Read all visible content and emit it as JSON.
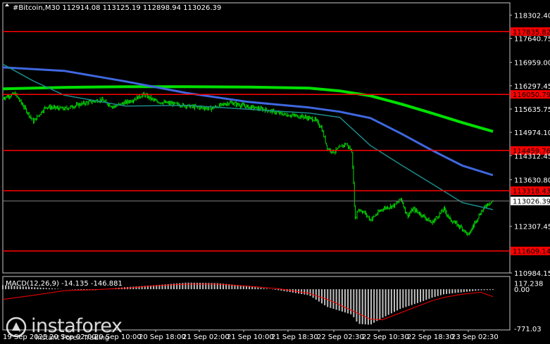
{
  "chart_data": [
    {
      "type": "candlestick",
      "title": "#Bitcoin,M30",
      "ohlc": {
        "open": "112914.08",
        "high": "113125.19",
        "low": "112898.94",
        "close": "113026.39"
      },
      "ylim": [
        110984.15,
        118650
      ],
      "y_ticks": [
        "118302.40",
        "117640.75",
        "116959.00",
        "116297.45",
        "115635.75",
        "114974.10",
        "114312.45",
        "113630.80",
        "112307.45",
        "110984.15"
      ],
      "x_ticks": [
        "19 Sep 2025",
        "20 Sep 02:00",
        "20 Sep 10:00",
        "20 Sep 18:00",
        "21 Sep 02:00",
        "21 Sep 10:00",
        "21 Sep 18:30",
        "22 Sep 02:30",
        "22 Sep 10:30",
        "22 Sep 18:30",
        "23 Sep 02:30"
      ],
      "current_price": "113026.39",
      "levels": [
        {
          "value": 117835.82,
          "label": "117835.82"
        },
        {
          "value": 116050.79,
          "label": "116050.79"
        },
        {
          "value": 114459.76,
          "label": "114459.76"
        },
        {
          "value": 113318.43,
          "label": "113318.43"
        },
        {
          "value": 111609.14,
          "label": "111609.14"
        }
      ],
      "ma_series": [
        {
          "color": "#00e000",
          "points": [
            [
              0,
              116210
            ],
            [
              10,
              116250
            ],
            [
              20,
              116270
            ],
            [
              30,
              116270
            ],
            [
              40,
              116260
            ],
            [
              50,
              116230
            ],
            [
              55,
              116150
            ],
            [
              60,
              116010
            ],
            [
              65,
              115780
            ],
            [
              70,
              115520
            ],
            [
              75,
              115250
            ],
            [
              80,
              115000
            ]
          ]
        },
        {
          "color": "#3f68e0",
          "points": [
            [
              0,
              116820
            ],
            [
              10,
              116720
            ],
            [
              20,
              116420
            ],
            [
              30,
              116090
            ],
            [
              40,
              115840
            ],
            [
              50,
              115680
            ],
            [
              55,
              115560
            ],
            [
              60,
              115380
            ],
            [
              65,
              114940
            ],
            [
              70,
              114470
            ],
            [
              75,
              114030
            ],
            [
              80,
              113760
            ]
          ]
        },
        {
          "color": "#1c8a8a",
          "points": [
            [
              0,
              116910
            ],
            [
              5,
              116430
            ],
            [
              10,
              116030
            ],
            [
              20,
              115720
            ],
            [
              30,
              115740
            ],
            [
              40,
              115630
            ],
            [
              50,
              115520
            ],
            [
              55,
              115400
            ],
            [
              60,
              114600
            ],
            [
              65,
              114050
            ],
            [
              70,
              113520
            ],
            [
              75,
              112980
            ],
            [
              80,
              112780
            ]
          ]
        }
      ],
      "close_path": [
        [
          0,
          115950
        ],
        [
          2,
          116070
        ],
        [
          4,
          115550
        ],
        [
          5,
          115280
        ],
        [
          7,
          115700
        ],
        [
          10,
          115640
        ],
        [
          13,
          115790
        ],
        [
          16,
          115900
        ],
        [
          18,
          115700
        ],
        [
          21,
          115880
        ],
        [
          23,
          116050
        ],
        [
          25,
          115850
        ],
        [
          28,
          115780
        ],
        [
          31,
          115700
        ],
        [
          34,
          115650
        ],
        [
          37,
          115820
        ],
        [
          40,
          115700
        ],
        [
          43,
          115610
        ],
        [
          46,
          115480
        ],
        [
          49,
          115420
        ],
        [
          51,
          115330
        ],
        [
          52,
          115110
        ],
        [
          53,
          114510
        ],
        [
          54,
          114420
        ],
        [
          56,
          114660
        ],
        [
          57,
          114420
        ],
        [
          57.5,
          112500
        ],
        [
          58,
          112800
        ],
        [
          59,
          112700
        ],
        [
          60,
          112490
        ],
        [
          62,
          112810
        ],
        [
          64,
          112910
        ],
        [
          65,
          113100
        ],
        [
          66,
          112600
        ],
        [
          67,
          112800
        ],
        [
          69,
          112550
        ],
        [
          70,
          112400
        ],
        [
          72,
          112800
        ],
        [
          73,
          112500
        ],
        [
          75,
          112250
        ],
        [
          76,
          112050
        ],
        [
          77,
          112400
        ],
        [
          78,
          112700
        ],
        [
          79,
          112930
        ],
        [
          80,
          113030
        ]
      ],
      "candle_count": 560
    },
    {
      "type": "bar",
      "title": "MACD(12,26,9)",
      "values_text": "-14.135 -146.881",
      "ylim": [
        -800,
        250
      ],
      "y_ticks": [
        "117.238",
        "0.00",
        "-771.03"
      ],
      "histogram_path": [
        [
          0,
          80
        ],
        [
          5,
          40
        ],
        [
          10,
          0
        ],
        [
          15,
          -20
        ],
        [
          20,
          40
        ],
        [
          25,
          80
        ],
        [
          30,
          130
        ],
        [
          35,
          120
        ],
        [
          40,
          60
        ],
        [
          45,
          -20
        ],
        [
          50,
          -120
        ],
        [
          53,
          -350
        ],
        [
          57,
          -500
        ],
        [
          58,
          -680
        ],
        [
          60,
          -700
        ],
        [
          62,
          -560
        ],
        [
          65,
          -380
        ],
        [
          68,
          -260
        ],
        [
          70,
          -170
        ],
        [
          72,
          -100
        ],
        [
          75,
          -60
        ],
        [
          78,
          -20
        ],
        [
          80,
          -14
        ]
      ],
      "signal_path": [
        [
          0,
          -200
        ],
        [
          5,
          -120
        ],
        [
          10,
          -30
        ],
        [
          15,
          -10
        ],
        [
          20,
          20
        ],
        [
          25,
          70
        ],
        [
          30,
          100
        ],
        [
          35,
          100
        ],
        [
          40,
          60
        ],
        [
          45,
          10
        ],
        [
          50,
          -80
        ],
        [
          53,
          -200
        ],
        [
          57,
          -420
        ],
        [
          60,
          -590
        ],
        [
          62,
          -600
        ],
        [
          65,
          -460
        ],
        [
          68,
          -320
        ],
        [
          70,
          -230
        ],
        [
          72,
          -160
        ],
        [
          75,
          -100
        ],
        [
          78,
          -60
        ],
        [
          80,
          -147
        ]
      ]
    }
  ],
  "branding": {
    "name": "instaforex",
    "tagline": "Instant Forex Trading"
  }
}
